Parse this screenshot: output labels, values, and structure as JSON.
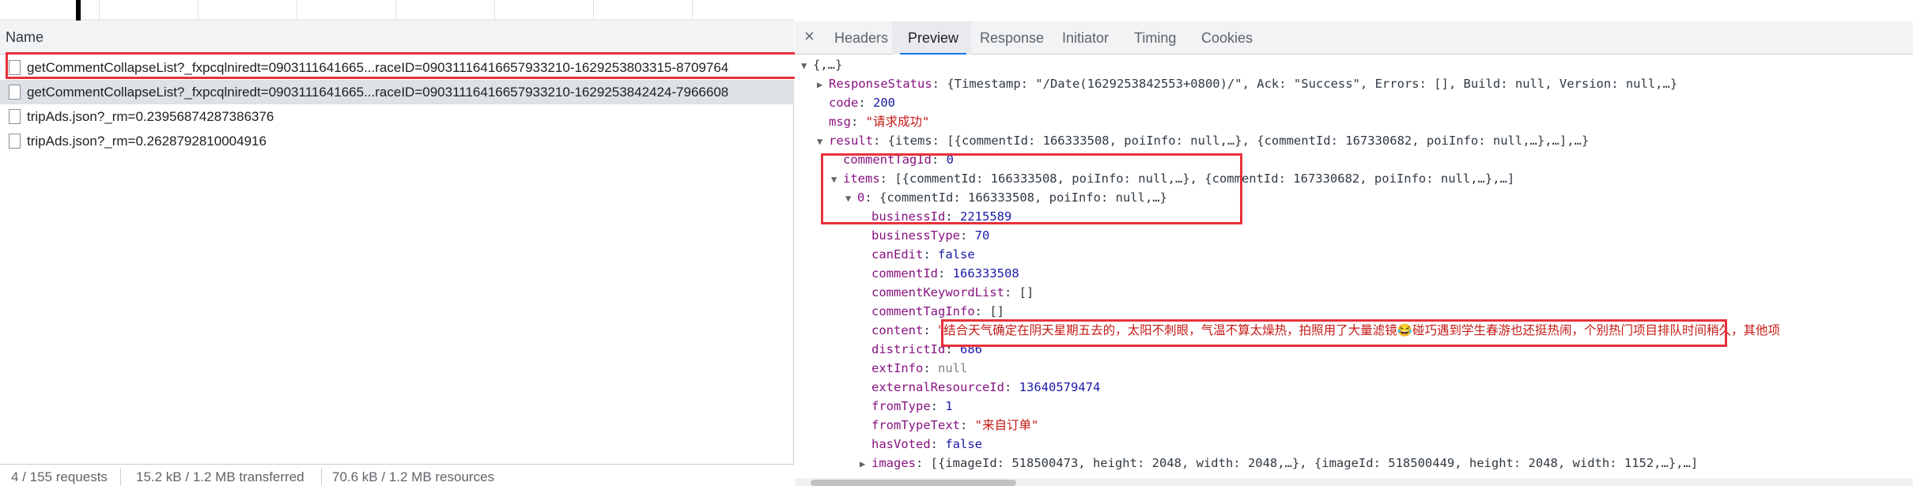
{
  "left": {
    "name_header": "Name",
    "requests": [
      {
        "label": "getCommentCollapseList?_fxpcqlniredt=0903111641665...raceID=09031116416657933210-1629253803315-8709764"
      },
      {
        "label": "getCommentCollapseList?_fxpcqlniredt=0903111641665...raceID=09031116416657933210-1629253842424-7966608"
      },
      {
        "label": "tripAds.json?_rm=0.23956874287386376"
      },
      {
        "label": "tripAds.json?_rm=0.2628792810004916"
      }
    ],
    "status": {
      "requests": "4 / 155 requests",
      "transferred": "15.2 kB / 1.2 MB transferred",
      "resources": "70.6 kB / 1.2 MB resources"
    }
  },
  "right": {
    "close_glyph": "×",
    "tabs": [
      "Headers",
      "Preview",
      "Response",
      "Initiator",
      "Timing",
      "Cookies"
    ],
    "active_tab": "Preview",
    "json": {
      "root": "{,…}",
      "response_status_key": "ResponseStatus",
      "response_status_val": "{Timestamp: \"/Date(1629253842553+0800)/\", Ack: \"Success\", Errors: [], Build: null, Version: null,…}",
      "code_key": "code",
      "code_val": "200",
      "msg_key": "msg",
      "msg_val": "\"请求成功\"",
      "result_key": "result",
      "result_val": "{items: [{commentId: 166333508, poiInfo: null,…}, {commentId: 167330682, poiInfo: null,…},…],…}",
      "comment_tag_id_key": "commentTagId",
      "comment_tag_id_val": "0",
      "items_key": "items",
      "items_val": "[{commentId: 166333508, poiInfo: null,…}, {commentId: 167330682, poiInfo: null,…},…]",
      "item0_key": "0",
      "item0_val": "{commentId: 166333508, poiInfo: null,…}",
      "business_id_key": "businessId",
      "business_id_val": "2215589",
      "business_type_key": "businessType",
      "business_type_val": "70",
      "can_edit_key": "canEdit",
      "can_edit_val": "false",
      "comment_id_key": "commentId",
      "comment_id_val": "166333508",
      "comment_keyword_list_key": "commentKeywordList",
      "comment_keyword_list_val": "[]",
      "comment_tag_info_key": "commentTagInfo",
      "comment_tag_info_val": "[]",
      "content_key": "content",
      "content_val_a": "\"结合天气确定在阴天星期五去的，太阳不刺眼，气温不算太燥热，拍照用了大量滤镜",
      "content_emoji": "😂",
      "content_val_b": "碰巧遇到学生春游也还挺热闹，个别热门项目排队时间稍久，其他项",
      "district_id_key": "districtId",
      "district_id_val": "686",
      "ext_info_key": "extInfo",
      "ext_info_val": "null",
      "external_resource_id_key": "externalResourceId",
      "external_resource_id_val": "13640579474",
      "from_type_key": "fromType",
      "from_type_val": "1",
      "from_type_text_key": "fromTypeText",
      "from_type_text_val": "\"来自订单\"",
      "has_voted_key": "hasVoted",
      "has_voted_val": "false",
      "images_key": "images",
      "images_val": "[{imageId: 518500473, height: 2048, width: 2048,…}, {imageId: 518500449, height: 2048, width: 1152,…},…]"
    }
  }
}
